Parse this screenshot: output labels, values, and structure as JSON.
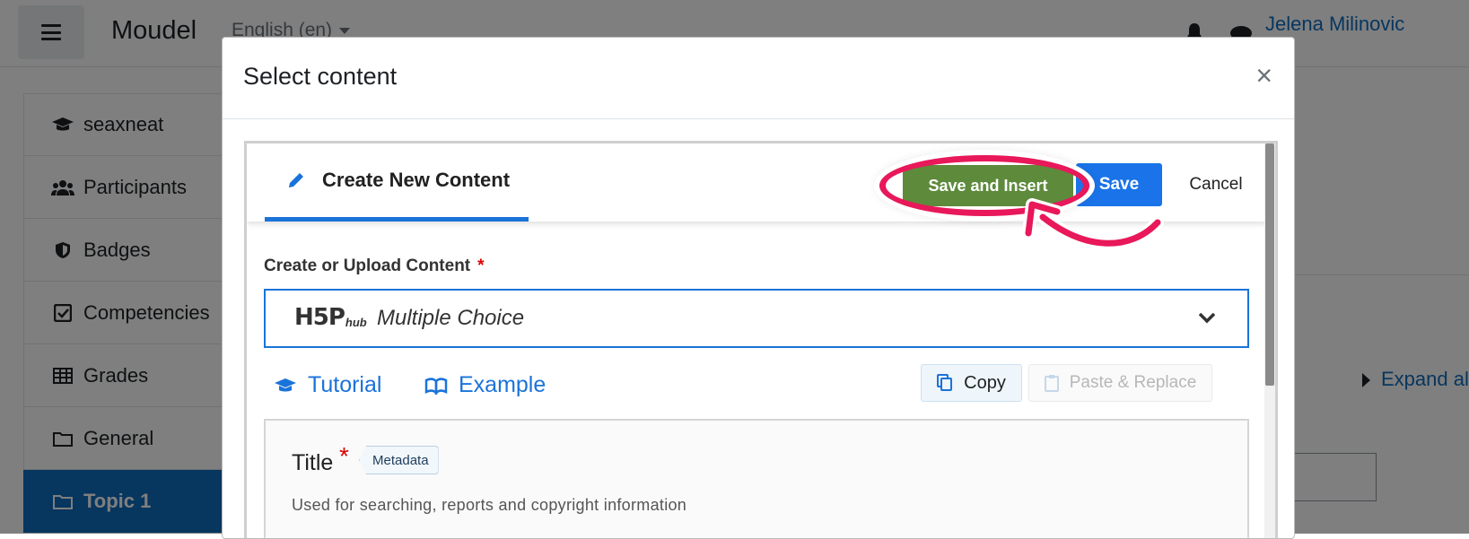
{
  "navbar": {
    "brand": "Moudel",
    "language": "English (en)",
    "username": "Jelena Milinovic"
  },
  "drawer": {
    "items": [
      {
        "label": "seaxneat",
        "icon": "graduation-cap-icon"
      },
      {
        "label": "Participants",
        "icon": "users-icon"
      },
      {
        "label": "Badges",
        "icon": "shield-icon"
      },
      {
        "label": "Competencies",
        "icon": "checkbox-icon"
      },
      {
        "label": "Grades",
        "icon": "table-icon"
      },
      {
        "label": "General",
        "icon": "folder-icon"
      },
      {
        "label": "Topic 1",
        "icon": "folder-icon"
      }
    ]
  },
  "page": {
    "expand_all": "Expand all"
  },
  "modal": {
    "title": "Select content",
    "close": "×",
    "h5p": {
      "tab_label": "Create New Content",
      "save_insert_label": "Save and Insert",
      "save_label": "Save",
      "cancel_label": "Cancel",
      "upload_label": "Create or Upload Content",
      "required_mark": "*",
      "hub_logo_main": "H5P",
      "hub_logo_sub": "hub",
      "content_type": "Multiple Choice",
      "tutorial_label": "Tutorial",
      "example_label": "Example",
      "copy_label": "Copy",
      "paste_label": "Paste & Replace",
      "title_label": "Title",
      "title_required": "*",
      "metadata_label": "Metadata",
      "title_description": "Used for searching, reports and copyright information"
    }
  },
  "colors": {
    "brand_blue": "#0f6cbf",
    "save_insert_green": "#5e8a3c",
    "save_blue": "#1a73e8",
    "highlight_pink": "#e8185a"
  }
}
